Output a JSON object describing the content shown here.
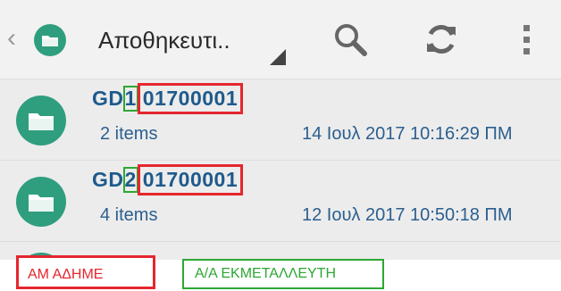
{
  "toolbar": {
    "title": "Αποθηκευτι..",
    "back_glyph": "‹",
    "icons": [
      "folder-icon",
      "search-icon",
      "refresh-icon",
      "more-vert-icon"
    ],
    "colors": {
      "icon_green": "#2f9e7f",
      "title_blue": "#1e5a8c"
    }
  },
  "items": [
    {
      "prefix": "GD",
      "digit": "1",
      "am": "01700001",
      "count": "2 items",
      "date": "14 Ιουλ 2017 10:16:29 ΠΜ"
    },
    {
      "prefix": "GD",
      "digit": "2",
      "am": "01700001",
      "count": "4 items",
      "date": "12 Ιουλ 2017 10:50:18 ΠΜ"
    }
  ],
  "partial_item": {
    "title": ""
  },
  "legend": {
    "red_label": "ΑΜ ΑΔΗΜΕ",
    "green_label": "Α/Α ΕΚΜΕΤΑΛΛΕΥΤΗ",
    "red_color": "#e5262e",
    "green_color": "#2ca833"
  }
}
